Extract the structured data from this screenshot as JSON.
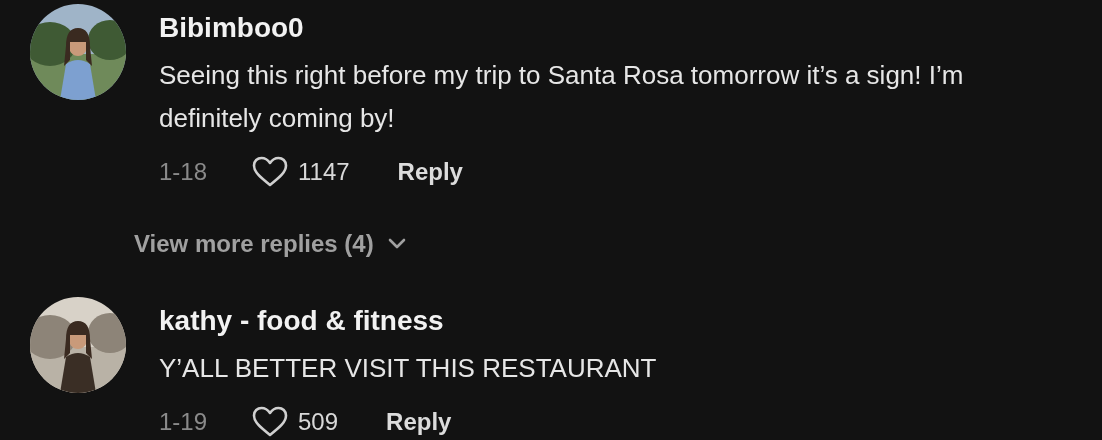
{
  "comments": [
    {
      "username": "Bibimboo0",
      "text": "Seeing this right before my trip to Santa Rosa tomorrow it’s a sign! I’m definitely coming by!",
      "date": "1-18",
      "likes": "1147",
      "reply": "Reply",
      "more_replies": "View more replies (4)"
    },
    {
      "username": "kathy - food & fitness",
      "text": "Y’ALL BETTER VISIT THIS RESTAURANT",
      "date": "1-19",
      "likes": "509",
      "reply": "Reply"
    }
  ]
}
